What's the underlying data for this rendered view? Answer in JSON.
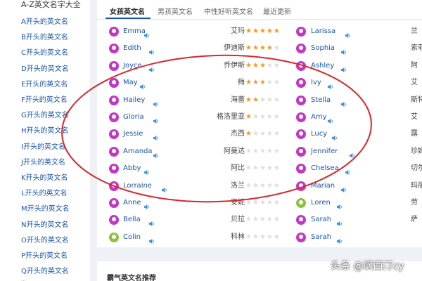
{
  "sidebar": {
    "title": "A-Z英文名字大全",
    "items": [
      {
        "label": "A开头的英文名"
      },
      {
        "label": "B开头的英文名"
      },
      {
        "label": "C开头的英文名"
      },
      {
        "label": "D开头的英文名"
      },
      {
        "label": "E开头的英文名"
      },
      {
        "label": "F开头的英文名"
      },
      {
        "label": "G开头的英文名"
      },
      {
        "label": "H开头的英文名"
      },
      {
        "label": "I开头的英文名"
      },
      {
        "label": "J开头的英文名"
      },
      {
        "label": "K开头的英文名"
      },
      {
        "label": "L开头的英文名"
      },
      {
        "label": "M开头的英文名"
      },
      {
        "label": "N开头的英文名"
      },
      {
        "label": "O开头的英文名"
      },
      {
        "label": "P开头的英文名"
      },
      {
        "label": "Q开头的英文名"
      }
    ],
    "footer": "..."
  },
  "tabs": [
    {
      "label": "女孩英文名",
      "active": true
    },
    {
      "label": "男孩英文名",
      "active": false
    },
    {
      "label": "中性好听英文名",
      "active": false
    },
    {
      "label": "最近更新",
      "active": false
    }
  ],
  "names_left": [
    {
      "name": "Emma",
      "cn": "艾玛",
      "rating": 5,
      "avatar": "magenta"
    },
    {
      "name": "Edith",
      "cn": "伊迪斯",
      "rating": 4,
      "avatar": "magenta"
    },
    {
      "name": "Joyce",
      "cn": "乔伊斯",
      "rating": 3,
      "avatar": "magenta"
    },
    {
      "name": "May",
      "cn": "梅",
      "rating": 3,
      "avatar": "magenta"
    },
    {
      "name": "Hailey",
      "cn": "海蕾",
      "rating": 2,
      "avatar": "magenta"
    },
    {
      "name": "Gloria",
      "cn": "格洛里亚",
      "rating": 1,
      "avatar": "magenta"
    },
    {
      "name": "Jessie",
      "cn": "杰西",
      "rating": 1,
      "avatar": "magenta"
    },
    {
      "name": "Amanda",
      "cn": "阿曼达",
      "rating": 0,
      "avatar": "magenta"
    },
    {
      "name": "Abby",
      "cn": "阿比",
      "rating": 0,
      "avatar": "magenta"
    },
    {
      "name": "Lorraine",
      "cn": "洛兰",
      "rating": 0,
      "avatar": "magenta"
    },
    {
      "name": "Anne",
      "cn": "安妮",
      "rating": 0,
      "avatar": "magenta"
    },
    {
      "name": "Bella",
      "cn": "贝拉",
      "rating": 0,
      "avatar": "magenta"
    },
    {
      "name": "Colin",
      "cn": "科林",
      "rating": 0,
      "avatar": "green"
    }
  ],
  "names_right": [
    {
      "name": "Larissa",
      "cn": "兰",
      "avatar": "magenta"
    },
    {
      "name": "Sophia",
      "cn": "索菲",
      "avatar": "magenta"
    },
    {
      "name": "Ashley",
      "cn": "阿",
      "avatar": "magenta"
    },
    {
      "name": "Ivy",
      "cn": "艾",
      "avatar": "magenta"
    },
    {
      "name": "Stella",
      "cn": "斯特",
      "avatar": "magenta"
    },
    {
      "name": "Amy",
      "cn": "艾",
      "avatar": "magenta"
    },
    {
      "name": "Lucy",
      "cn": "露",
      "avatar": "magenta"
    },
    {
      "name": "Jennifer",
      "cn": "珍妮",
      "avatar": "magenta"
    },
    {
      "name": "Chelsea",
      "cn": "切尔",
      "avatar": "magenta"
    },
    {
      "name": "Marian",
      "cn": "玛丽",
      "avatar": "magenta"
    },
    {
      "name": "Loren",
      "cn": "劳",
      "avatar": "green"
    },
    {
      "name": "Sarah",
      "cn": "萨",
      "avatar": "magenta"
    },
    {
      "name": "Sarah",
      "cn": "",
      "avatar": "magenta"
    }
  ],
  "bottom": {
    "title": "霸气英文名推荐"
  },
  "watermark": "头条 @飒西汀cy",
  "colors": {
    "accent": "#1c55a8",
    "avatar": "#c437c6",
    "avatar_alt": "#8dc23e",
    "star": "#f39a1f",
    "annotation": "#d9262b"
  }
}
